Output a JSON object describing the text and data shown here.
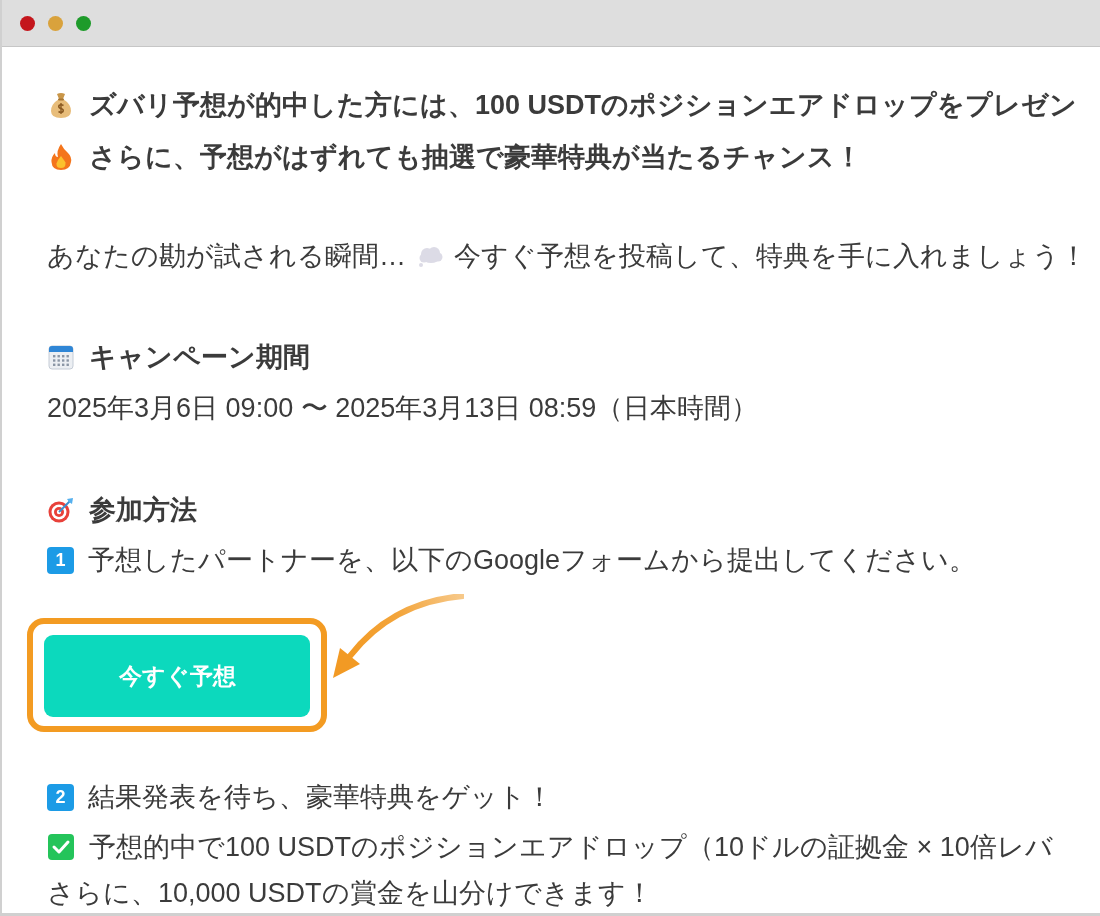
{
  "intro": [
    {
      "text": "ズバリ予想が的中した方には、100 USDTのポジションエアドロップをプレゼン"
    },
    {
      "text": "さらに、予想がはずれても抽選で豪華特典が当たるチャンス！"
    }
  ],
  "teaser": {
    "before": "あなたの勘が試される瞬間…",
    "after": "今すぐ予想を投稿して、特典を手に入れましょう！"
  },
  "period": {
    "heading": "キャンペーン期間",
    "text": "2025年3月6日 09:00 〜 2025年3月13日 08:59（日本時間）"
  },
  "how_to_join": {
    "heading": "参加方法",
    "step_1": {
      "number": "1",
      "text": "予想したパートナーを、以下のGoogleフォームから提出してください。"
    },
    "button": {
      "label": "今すぐ予想"
    },
    "step_2": {
      "number": "2",
      "text": "結果発表を待ち、豪華特典をゲット！"
    },
    "reward": "予想的中で100 USDTのポジションエアドロップ（10ドルの証拠金 × 10倍レバ",
    "closing": "さらに、10,000 USDTの賞金を山分けできます！"
  }
}
